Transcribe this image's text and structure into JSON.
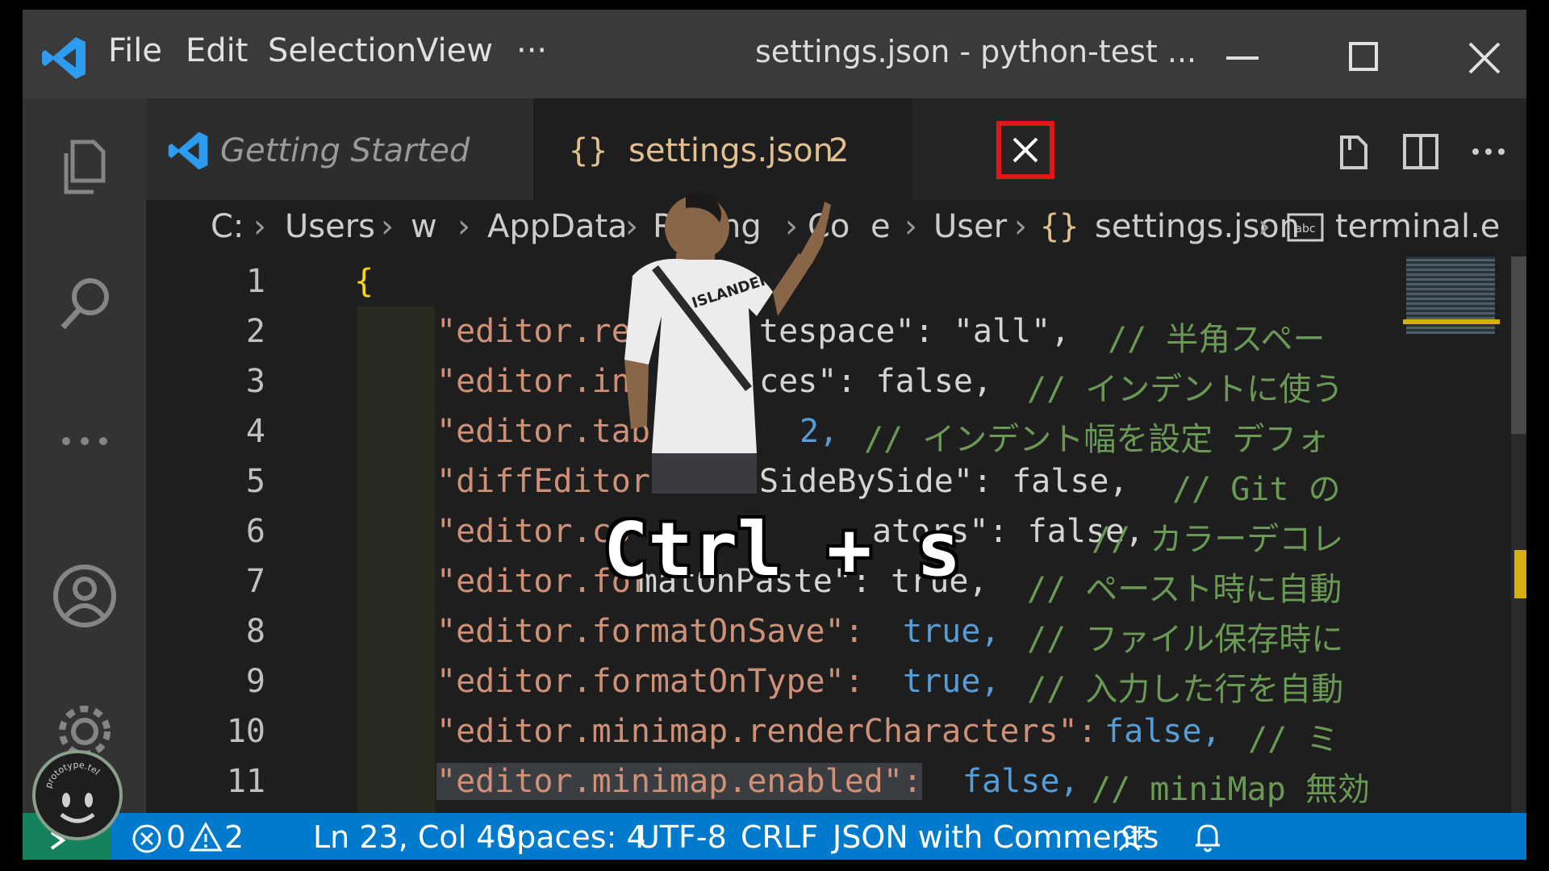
{
  "titlebar": {
    "menu": [
      "File",
      "Edit",
      "Selection",
      "View",
      "···"
    ],
    "title": "settings.json - python-test ..."
  },
  "tabs": [
    {
      "label": "Getting Started"
    },
    {
      "label": "settings.json",
      "badge": "2"
    }
  ],
  "breadcrumb": [
    "C:",
    "Users",
    "w",
    "AppData",
    "Ro",
    "ng",
    "Co",
    "e",
    "User",
    "settings.json",
    "terminal.e"
  ],
  "editor": {
    "lines": [
      {
        "num": "1",
        "key": "{",
        "rest": "",
        "comment": ""
      },
      {
        "num": "2",
        "key": "\"editor.ren",
        "rest": "tespace\": \"all\",",
        "comment": "// 半角スペー"
      },
      {
        "num": "3",
        "key": "\"editor.ins",
        "rest": "ces\": false,",
        "comment": "// インデントに使う"
      },
      {
        "num": "4",
        "key": "\"editor.tab",
        "rest": "2,",
        "comment": "// インデント幅を設定 デフォ"
      },
      {
        "num": "5",
        "key": "\"diffEditor.",
        "rest": "SideBySide\": false,",
        "comment": "// Git の"
      },
      {
        "num": "6",
        "key": "\"editor.co",
        "rest": "ators\": false,",
        "comment": "// カラーデコレ"
      },
      {
        "num": "7",
        "key": "\"editor.for",
        "rest": "matOnPaste\": true,",
        "comment": "// ペースト時に自動"
      },
      {
        "num": "8",
        "key": "\"editor.formatOnSave\":",
        "rest": "true,",
        "comment": "// ファイル保存時に"
      },
      {
        "num": "9",
        "key": "\"editor.formatOnType\":",
        "rest": "true,",
        "comment": "// 入力した行を自動"
      },
      {
        "num": "10",
        "key": "\"editor.minimap.renderCharacters\":",
        "rest": "false,",
        "comment": "// ミ"
      },
      {
        "num": "11",
        "key": "\"editor.minimap.enabled\":",
        "rest": "false,",
        "comment": "// miniMap 無効"
      }
    ]
  },
  "statusbar": {
    "errors": "0",
    "warnings": "2",
    "position": "Ln 23, Col 40",
    "spaces": "Spaces: 4",
    "encoding": "UTF-8",
    "eol": "CRLF",
    "language": "JSON with Comments"
  },
  "overlay": {
    "caption": "Ctrl + s",
    "watermark_text": "prototype.tel",
    "person_shirt_text": "ISLANDERS"
  },
  "colors": {
    "accent": "#007acc",
    "highlight_box": "#e01818",
    "json_braces": "#e2c08d"
  }
}
